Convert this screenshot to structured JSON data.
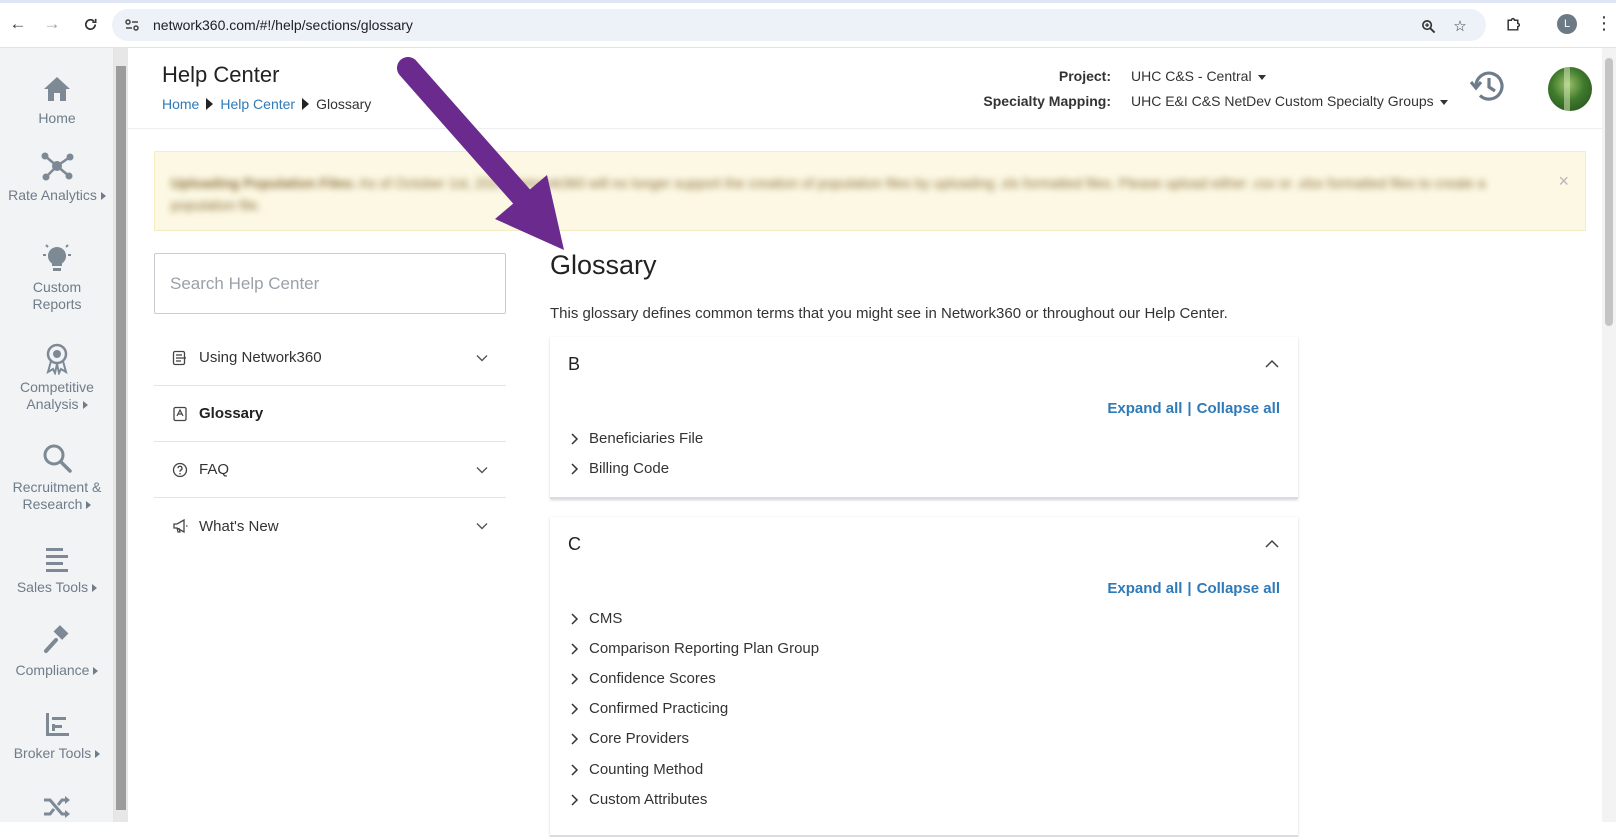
{
  "browser": {
    "url": "network360.com/#!/help/sections/glossary",
    "profile_initial": "L"
  },
  "rail": {
    "items": [
      {
        "label": "Home",
        "icon": "home-icon",
        "has_caret": false
      },
      {
        "label": "Rate Analytics",
        "icon": "network-icon",
        "has_caret": true
      },
      {
        "label": "Custom Reports",
        "icon": "lightbulb-icon",
        "has_caret": false
      },
      {
        "label": "Competitive Analysis",
        "icon": "award-icon",
        "has_caret": true
      },
      {
        "label": "Recruitment & Research",
        "icon": "search-icon",
        "has_caret": true
      },
      {
        "label": "Sales Tools",
        "icon": "lines-icon",
        "has_caret": true
      },
      {
        "label": "Compliance",
        "icon": "gavel-icon",
        "has_caret": true
      },
      {
        "label": "Broker Tools",
        "icon": "bar-chart-icon",
        "has_caret": true
      }
    ]
  },
  "header": {
    "title": "Help Center",
    "breadcrumb": {
      "home": "Home",
      "help_center": "Help Center",
      "current": "Glossary"
    },
    "project_label": "Project:",
    "project_value": "UHC C&S - Central",
    "specialty_label": "Specialty Mapping:",
    "specialty_value": "UHC E&I C&S NetDev Custom Specialty Groups"
  },
  "alert": {
    "bold": "Uploading Population Files:",
    "text": " As of October 1st, 2024 Network360 will no longer support the creation of population files by uploading .xls formatted files. Please upload either .csv or .xlsx formatted files to create a population file.",
    "close": "×"
  },
  "help_nav": {
    "search_placeholder": "Search Help Center",
    "items": [
      {
        "label": "Using Network360",
        "icon": "document-lines-icon",
        "expandable": true,
        "active": false
      },
      {
        "label": "Glossary",
        "icon": "book-icon",
        "expandable": false,
        "active": true
      },
      {
        "label": "FAQ",
        "icon": "question-circle-icon",
        "expandable": true,
        "active": false
      },
      {
        "label": "What's New",
        "icon": "megaphone-icon",
        "expandable": true,
        "active": false
      }
    ]
  },
  "main": {
    "title": "Glossary",
    "description": "This glossary defines common terms that you might see in Network360 or throughout our Help Center.",
    "expand_all": "Expand all",
    "separator": "|",
    "collapse_all": "Collapse all",
    "sections": [
      {
        "letter": "B",
        "terms": [
          "Beneficiaries File",
          "Billing Code"
        ]
      },
      {
        "letter": "C",
        "terms": [
          "CMS",
          "Comparison Reporting Plan Group",
          "Confidence Scores",
          "Confirmed Practicing",
          "Core Providers",
          "Counting Method",
          "Custom Attributes"
        ]
      }
    ]
  },
  "colors": {
    "link": "#2f7ab8",
    "rail_text": "#6f7c89",
    "alert_bg": "#fcf8e3",
    "annotation_arrow": "#6a2a8e"
  }
}
